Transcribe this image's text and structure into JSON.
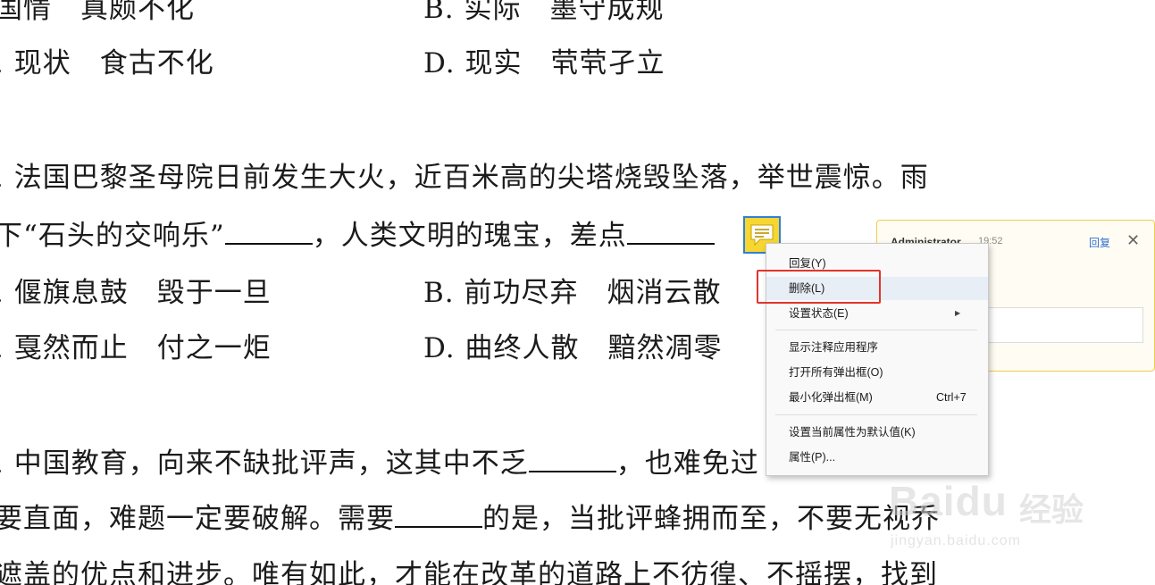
{
  "document": {
    "line1": {
      "left": "国情　真颇不化",
      "right": "B. 实际　墨守成规"
    },
    "line2": {
      "left": ". 现状　食古不化",
      "right": "D. 现实　茕茕孑立"
    },
    "q2_line1": ". 法国巴黎圣母院日前发生大火，近百米高的尖塔烧毁坠落，举世震惊。雨",
    "q2_line2_a": "下“石头的交响乐”",
    "q2_line2_b": "，人类文明的瑰宝，差点",
    "q2_optA": ". 偃旗息鼓　毁于一旦",
    "q2_optB": "B. 前功尽弃　烟消云散",
    "q2_optC": ". 戛然而止　付之一炬",
    "q2_optD": "D. 曲终人散　黯然凋零",
    "q3_line1_a": ". 中国教育，向来不缺批评声，这其中不乏",
    "q3_line1_b": "，也难免过",
    "q3_line2_a": "要直面，难题一定要破解。需要",
    "q3_line2_b": "的是，当批评蜂拥而至，不要无视乔",
    "q3_line3": "遮盖的优点和进步。唯有如此，才能在改革的道路上不彷徨、不摇摆，找到"
  },
  "comment_popup": {
    "author": "Administrator",
    "time": "19:52",
    "reply_label": "回复",
    "close_symbol": "✕"
  },
  "context_menu": {
    "items": [
      {
        "label": "回复(Y)",
        "shortcut": "",
        "submenu": false
      },
      {
        "label": "删除(L)",
        "shortcut": "",
        "submenu": false
      },
      {
        "label": "设置状态(E)",
        "shortcut": "",
        "submenu": true
      },
      {
        "label": "显示注释应用程序",
        "shortcut": "",
        "submenu": false
      },
      {
        "label": "打开所有弹出框(O)",
        "shortcut": "",
        "submenu": false
      },
      {
        "label": "最小化弹出框(M)",
        "shortcut": "Ctrl+7",
        "submenu": false
      },
      {
        "label": "设置当前属性为默认值(K)",
        "shortcut": "",
        "submenu": false
      },
      {
        "label": "属性(P)...",
        "shortcut": "",
        "submenu": false
      }
    ],
    "submenu_arrow": "▶"
  },
  "watermark": {
    "brand": "Bai",
    "brand_du": "du",
    "brand_cn": "经验",
    "site": "jingyan.baidu.com"
  },
  "colors": {
    "comment_icon": "#f7d631",
    "highlight": "#e0352b",
    "popup_border": "#f1cd4a"
  }
}
